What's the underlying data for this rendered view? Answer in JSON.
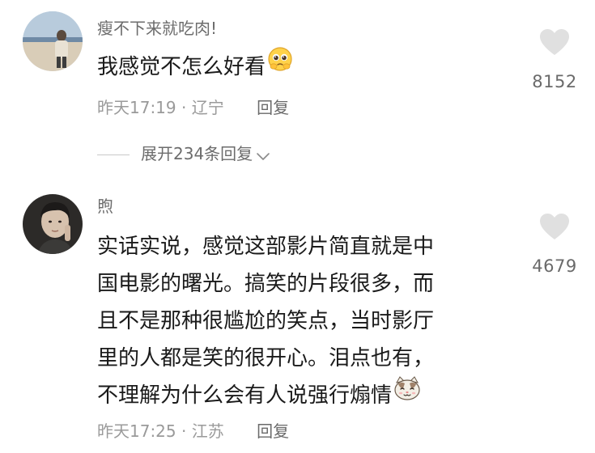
{
  "comments": [
    {
      "username": "瘦不下来就吃肉!",
      "text_lines": [
        "我感觉不怎么好看"
      ],
      "emoji": "pleading-face",
      "time": "昨天17:19",
      "separator": "·",
      "location": "辽宁",
      "reply_label": "回复",
      "like_count": "8152",
      "expand_label": "展开234条回复"
    },
    {
      "username": "煦",
      "text_lines": [
        "实话实说，感觉这部影片简直就是中",
        "国电影的曙光。搞笑的片段很多，而",
        "且不是那种很尴尬的笑点，当时影厅",
        "里的人都是笑的很开心。泪点也有，",
        "不理解为什么会有人说强行煽情"
      ],
      "emoji": "cat-face",
      "time": "昨天17:25",
      "separator": "·",
      "location": "江苏",
      "reply_label": "回复",
      "like_count": "4679"
    }
  ],
  "colors": {
    "username": "#6c6c6c",
    "text": "#1a1a1a",
    "meta": "#9a9a9a",
    "like_icon": "#e0e0e0"
  }
}
